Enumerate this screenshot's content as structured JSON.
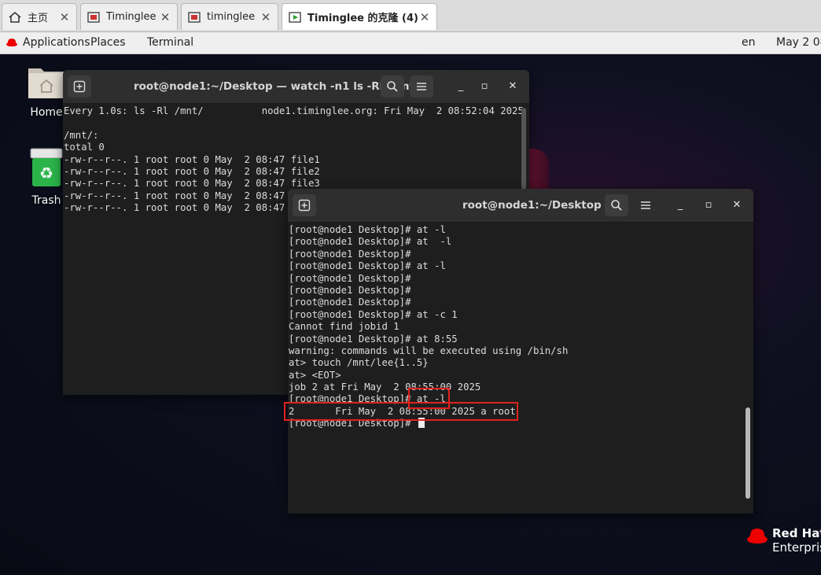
{
  "tabs": [
    {
      "label": "主页",
      "icon": "home-icon"
    },
    {
      "label": "Timinglee",
      "icon": "vm-icon"
    },
    {
      "label": "timinglee",
      "icon": "vm-icon"
    },
    {
      "label": "Timinglee 的克隆 (4)",
      "icon": "vm-running-icon",
      "active": true
    }
  ],
  "topbar": {
    "applications": "Applications",
    "places": "Places",
    "terminal": "Terminal",
    "language": "en",
    "clock": "May 2  08"
  },
  "desktop": {
    "home_label": "Home",
    "trash_label": "Trash",
    "brand_line1": "Red Hat",
    "brand_line2": "Enterpris",
    "brand_color": "#ee0000"
  },
  "watch_window": {
    "title": "root@node1:~/Desktop — watch -n1 ls -Rl /mnt/",
    "lines": [
      "Every 1.0s: ls -Rl /mnt/          node1.timinglee.org: Fri May  2 08:52:04 2025",
      "",
      "/mnt/:",
      "total 0",
      "-rw-r--r--. 1 root root 0 May  2 08:47 file1",
      "-rw-r--r--. 1 root root 0 May  2 08:47 file2",
      "-rw-r--r--. 1 root root 0 May  2 08:47 file3",
      "-rw-r--r--. 1 root root 0 May  2 08:47",
      "-rw-r--r--. 1 root root 0 May  2 08:47"
    ]
  },
  "desktop_window": {
    "title": "root@node1:~/Desktop",
    "lines": [
      "[root@node1 Desktop]# at -l",
      "[root@node1 Desktop]# at  -l",
      "[root@node1 Desktop]#",
      "[root@node1 Desktop]# at -l",
      "[root@node1 Desktop]#",
      "[root@node1 Desktop]#",
      "[root@node1 Desktop]#",
      "[root@node1 Desktop]# at -c 1",
      "Cannot find jobid 1",
      "[root@node1 Desktop]# at 8:55",
      "warning: commands will be executed using /bin/sh",
      "at> touch /mnt/lee{1..5}",
      "at> <EOT>",
      "job 2 at Fri May  2 08:55:00 2025",
      "[root@node1 Desktop]# at -l",
      "2       Fri May  2 08:55:00 2025 a root"
    ],
    "prompt": "[root@node1 Desktop]# "
  },
  "highlight_color": "#e0221e"
}
